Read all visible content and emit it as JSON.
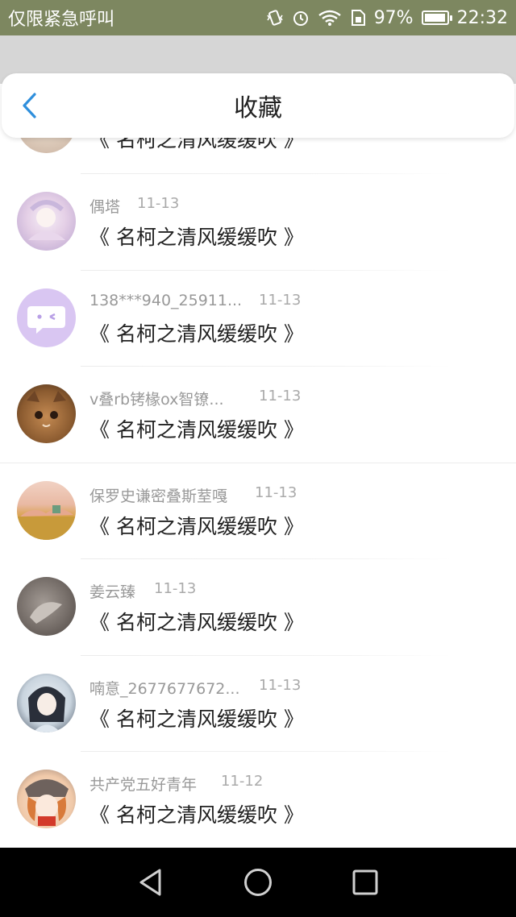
{
  "status_bar": {
    "emergency_text": "仅限紧急呼叫",
    "battery_percent": "97%",
    "time": "22:32",
    "battery_level": 0.97,
    "icons": [
      "vibrate-icon",
      "alarm-icon",
      "wifi-icon",
      "sim-icon",
      "battery-icon"
    ]
  },
  "header": {
    "title": "收藏",
    "back_icon": "chevron-left-icon",
    "accent_color": "#2f8fdc"
  },
  "favorites": [
    {
      "name": "",
      "date": "",
      "title": "《 名柯之清风缓缓吹 》"
    },
    {
      "name": "偶塔",
      "date": "11-13",
      "title": "《 名柯之清风缓缓吹 》"
    },
    {
      "name": "138***940_25911...",
      "date": "11-13",
      "title": "《 名柯之清风缓缓吹 》"
    },
    {
      "name": "v叠rb铐椽ox智镣...",
      "date": "11-13",
      "title": "《 名柯之清风缓缓吹 》"
    },
    {
      "name": "保罗史谦密叠斯荎嘎",
      "date": "11-13",
      "title": "《 名柯之清风缓缓吹 》"
    },
    {
      "name": "姜云臻",
      "date": "11-13",
      "title": "《 名柯之清风缓缓吹 》"
    },
    {
      "name": "喃意_2677677672...",
      "date": "11-13",
      "title": "《 名柯之清风缓缓吹 》"
    },
    {
      "name": "共产党五好青年",
      "date": "11-12",
      "title": "《 名柯之清风缓缓吹 》"
    }
  ],
  "bottom_nav": {
    "back": "triangle-back-icon",
    "home": "circle-home-icon",
    "recents": "square-recents-icon"
  }
}
